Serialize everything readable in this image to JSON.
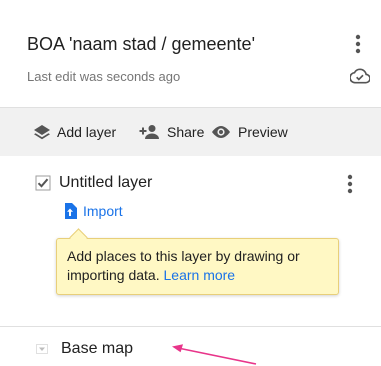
{
  "header": {
    "title": "BOA 'naam stad / gemeente'",
    "last_edit": "Last edit was seconds ago",
    "icons": [
      "more-vert-icon",
      "cloud-done-icon"
    ]
  },
  "toolbar": {
    "add_layer": "Add layer",
    "share": "Share",
    "preview": "Preview",
    "icons": [
      "layers-icon",
      "person-add-icon",
      "eye-icon"
    ]
  },
  "layer": {
    "checked": true,
    "title": "Untitled layer",
    "import_label": "Import"
  },
  "tooltip": {
    "text": "Add places to this layer by drawing or importing data.",
    "link": "Learn more"
  },
  "base_map": {
    "label": "Base map"
  },
  "colors": {
    "accent": "#1a73e8",
    "tooltip_bg": "#fff8c4",
    "annotation_arrow": "#e8358a",
    "toolbar_bg": "#f1f1f1"
  }
}
